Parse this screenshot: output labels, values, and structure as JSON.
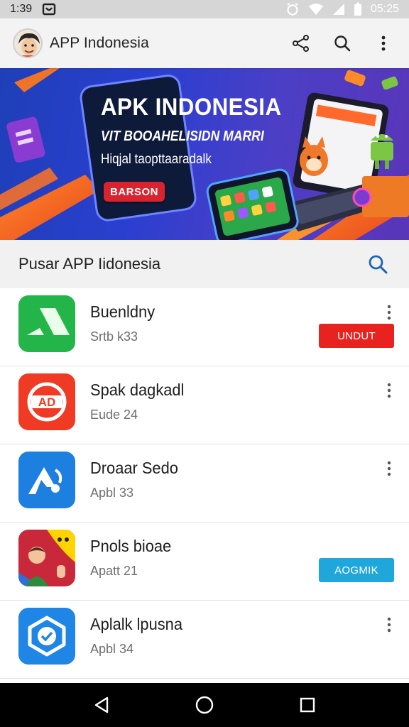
{
  "status_bar": {
    "time": "1:39",
    "clock": "05:25"
  },
  "app_bar": {
    "title": "APP Indonesia",
    "icons": [
      "share-icon",
      "search-icon",
      "more-vert-icon"
    ]
  },
  "banner": {
    "title": "APK INDONESIA",
    "subtitle": "VIT BOOAHELISIDN MARRI",
    "tagline": "Hiqjal taopttaaradalk",
    "cta": "BARSON"
  },
  "section": {
    "title": "Pusar APP Iidonesia"
  },
  "apps": [
    {
      "name": "Buenldny",
      "meta": "Srtb k33",
      "action": "UNDUT",
      "action_color": "#e8231f"
    },
    {
      "name": "Spak dagkadl",
      "meta": "Eude 24",
      "action": "",
      "action_color": ""
    },
    {
      "name": "Droaar Sedo",
      "meta": "Apbl 33",
      "action": "",
      "action_color": ""
    },
    {
      "name": "Pnols bioae",
      "meta": "Apatt 21",
      "action": "AOGMIK",
      "action_color": "#1fa7dc"
    },
    {
      "name": "Aplalk lpusna",
      "meta": "Apbl 34",
      "action": "",
      "action_color": ""
    }
  ],
  "colors": {
    "accent_red": "#e8231f",
    "accent_blue": "#1fa7dc",
    "banner_blue": "#2a3fd0",
    "search_blue": "#2062b5"
  }
}
